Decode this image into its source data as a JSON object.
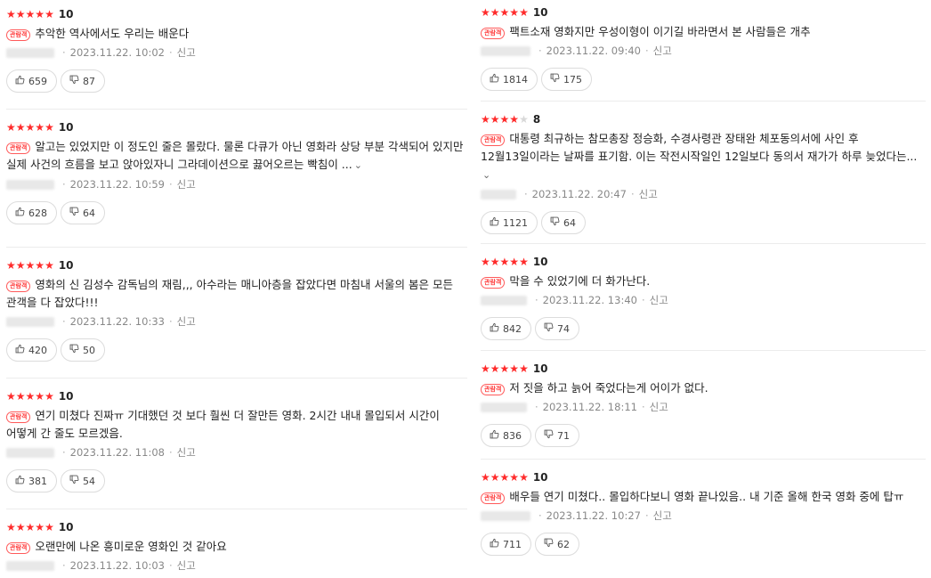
{
  "badge_text": "관람객",
  "report_label": "신고",
  "more_icon": "chevron-down-icon",
  "colors": {
    "star": "#ff2b2b",
    "star_off": "#d8d8d8",
    "badge": "#ff3a3a"
  },
  "left": [
    {
      "stars": 5,
      "score": "10",
      "text": "추악한 역사에서도 우리는 배운다",
      "date": "2023.11.22. 10:02",
      "likes": "659",
      "dislikes": "87"
    },
    {
      "stars": 5,
      "score": "10",
      "text": "알고는 있었지만 이 정도인 줄은 몰랐다. 물론 다큐가 아닌 영화라 상당 부분 각색되어 있지만 실제 사건의 흐름을 보고 앉아있자니 그라데이션으로 끓어오르는 빡침이 ...",
      "more": true,
      "date": "2023.11.22. 10:59",
      "likes": "628",
      "dislikes": "64"
    },
    {
      "stars": 5,
      "score": "10",
      "text": "영화의 신 김성수 감독님의 재림,,, 아수라는 매니아층을 잡았다면 마침내 서울의 봄은 모든 관객을 다 잡았다!!!",
      "date": "2023.11.22. 10:33",
      "likes": "420",
      "dislikes": "50"
    },
    {
      "stars": 5,
      "score": "10",
      "text": "연기 미쳤다 진짜ㅠ 기대했던 것 보다 훨씬 더 잘만든 영화. 2시간 내내 몰입되서 시간이 어떻게 간 줄도 모르겠음.",
      "date": "2023.11.22. 11:08",
      "likes": "381",
      "dislikes": "54"
    },
    {
      "stars": 5,
      "score": "10",
      "text": "오랜만에 나온 흥미로운 영화인 것 같아요",
      "date": "2023.11.22. 10:03"
    }
  ],
  "right": [
    {
      "stars": 5,
      "score": "10",
      "text": "팩트소재 영화지만 우성이형이 이기길 바라면서 본 사람들은 개추",
      "date": "2023.11.22. 09:40",
      "likes": "1814",
      "dislikes": "175"
    },
    {
      "stars": 4,
      "score": "8",
      "text": "대통령 최규하는 참모총장 정승화, 수경사령관 장태완 체포동의서에 사인 후 12월13일이라는 날짜를 표기함. 이는 작전시작일인 12일보다 동의서 재가가 하루 늦었다는...",
      "more": true,
      "date": "2023.11.22. 20:47",
      "likes": "1121",
      "dislikes": "64"
    },
    {
      "stars": 5,
      "score": "10",
      "text": "막을 수 있었기에 더 화가난다.",
      "date": "2023.11.22. 13:40",
      "likes": "842",
      "dislikes": "74"
    },
    {
      "stars": 5,
      "score": "10",
      "text": "저 짓을 하고 늙어 죽었다는게 어이가 없다.",
      "date": "2023.11.22. 18:11",
      "likes": "836",
      "dislikes": "71"
    },
    {
      "stars": 5,
      "score": "10",
      "text": "배우들 연기 미쳤다.. 몰입하다보니 영화 끝나있음.. 내 기준 올해 한국 영화 중에 탑ㅠ",
      "date": "2023.11.22. 10:27",
      "likes": "711",
      "dislikes": "62"
    }
  ]
}
